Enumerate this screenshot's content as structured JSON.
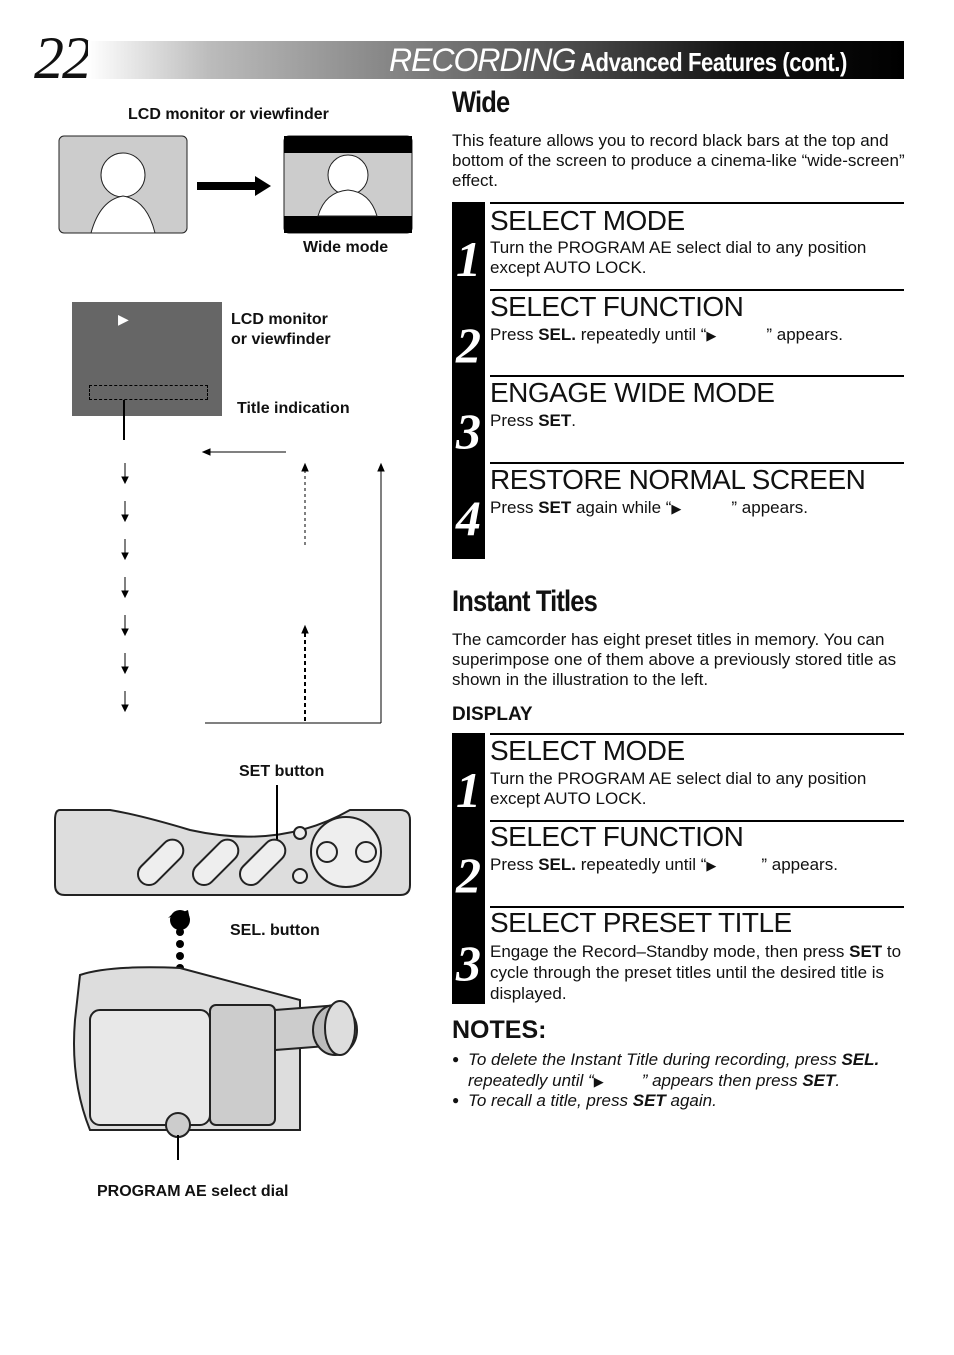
{
  "header": {
    "page_number": "22",
    "section": "RECORDING",
    "title": "Advanced Features (cont.)"
  },
  "illustrations": {
    "lcd_label": "LCD monitor or viewfinder",
    "wide_mode_label": "Wide mode",
    "lcd_label2_line1": "LCD monitor",
    "lcd_label2_line2": "or viewfinder",
    "title_indication": "Title indication",
    "set_button": "SET button",
    "sel_button": "SEL. button",
    "program_ae": "PROGRAM AE select dial"
  },
  "wide": {
    "heading": "Wide",
    "intro": "This feature allows you to record black bars at the top and bottom of the screen to produce a cinema-like “wide-screen” effect.",
    "steps": [
      {
        "num": "1",
        "title": "SELECT MODE",
        "text": "Turn the PROGRAM AE select dial to any position except AUTO LOCK."
      },
      {
        "num": "2",
        "title": "SELECT FUNCTION",
        "pre": "Press ",
        "key": "SEL.",
        "mid": " repeatedly until “",
        "post": "” appears."
      },
      {
        "num": "3",
        "title": "ENGAGE WIDE MODE",
        "pre": "Press ",
        "key": "SET",
        "post": "."
      },
      {
        "num": "4",
        "title": "RESTORE NORMAL SCREEN",
        "pre": "Press ",
        "key": "SET",
        "mid": " again while “",
        "post": "” appears."
      }
    ]
  },
  "titles": {
    "heading": "Instant Titles",
    "intro": "The camcorder has eight preset titles in memory. You can superimpose one of them above a previously stored title as shown in the illustration to the left.",
    "subheading": "DISPLAY",
    "steps": [
      {
        "num": "1",
        "title": "SELECT MODE",
        "text": "Turn the PROGRAM AE select dial to any position except AUTO LOCK."
      },
      {
        "num": "2",
        "title": "SELECT FUNCTION",
        "pre": "Press ",
        "key": "SEL.",
        "mid": " repeatedly until “",
        "post": "” appears."
      },
      {
        "num": "3",
        "title": "SELECT PRESET TITLE",
        "pre": "Engage the Record–Standby mode, then press ",
        "key": "SET",
        "post": " to cycle through the preset titles until the desired title is displayed."
      }
    ]
  },
  "notes": {
    "heading": "NOTES:",
    "n1_pre": "To delete the Instant Title during recording, press ",
    "n1_key": "SEL.",
    "n1_mid": " repeatedly until “",
    "n1_mid2": "” appears then press ",
    "n1_key2": "SET",
    "n1_post": ".",
    "n2_pre": "To recall a title, press ",
    "n2_key": "SET",
    "n2_post": " again."
  },
  "icons": {
    "play": "▶",
    "bullet": "●"
  }
}
